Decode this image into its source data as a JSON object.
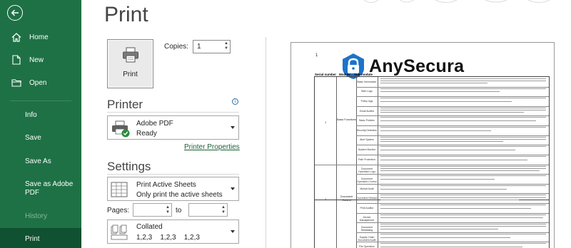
{
  "nav": {
    "items": [
      {
        "label": "Home",
        "icon": "home-icon"
      },
      {
        "label": "New",
        "icon": "new-document-icon"
      },
      {
        "label": "Open",
        "icon": "folder-icon"
      }
    ],
    "info": "Info",
    "save": "Save",
    "save_as": "Save As",
    "save_adobe": "Save as Adobe PDF",
    "history": "History",
    "print": "Print"
  },
  "main": {
    "title": "Print",
    "print_button": "Print",
    "copies_label": "Copies:",
    "copies_value": "1"
  },
  "printer": {
    "heading": "Printer",
    "name": "Adobe PDF",
    "status": "Ready",
    "properties_link": "Printer Properties"
  },
  "settings": {
    "heading": "Settings",
    "scope_title": "Print Active Sheets",
    "scope_desc": "Only print the active sheets",
    "pages_label": "Pages:",
    "to_label": "to",
    "collate_title": "Collated",
    "collate_desc": "1,2,3    1,2,3    1,2,3"
  },
  "preview": {
    "page_number": "1",
    "logo_text": "AnySecura",
    "col_serial": "Serial number",
    "col_module": "Module",
    "col_submodule": "Sub-module",
    "group1_num": "1",
    "group1_label": "Basic Functions",
    "group2_num": "2",
    "group2_label": "Document Control",
    "rows": [
      "Basic Information",
      "Web Logs",
      "Policy logs",
      "Email Auditor",
      "Basic Policies",
      "Security Detection",
      "Alert System",
      "System Monitor",
      "Path Protection",
      "Document Operation Logs",
      "Document Operation Control",
      "Mutual Audit",
      "Document Retrace",
      "Print Auditor",
      "Device Management",
      "Document Retaliating",
      "Supply Chain Document Audit",
      "File Operation Control"
    ]
  },
  "colors": {
    "nav_bg": "#1e7145",
    "nav_selected": "#0f5130",
    "accent_link": "#1e5f3a"
  }
}
